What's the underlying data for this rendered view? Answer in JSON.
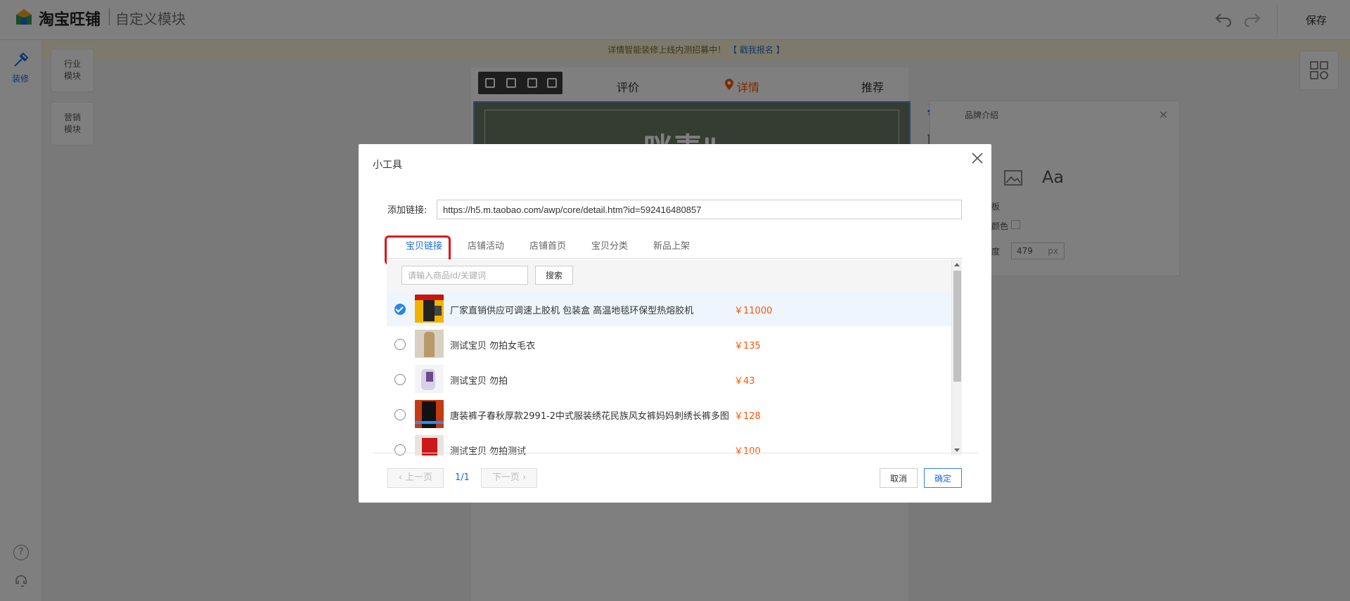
{
  "app": {
    "brand": "淘宝旺铺",
    "subtitle": "自定义模块",
    "save_label": "保存"
  },
  "notice": {
    "text": "详情智能装修上线内测招募中！",
    "link": "【 戳我报名 】"
  },
  "left_rail": {
    "decorate_label": "装修",
    "help_glyph": "?"
  },
  "modules": [
    {
      "line1": "行业",
      "line2": "模块"
    },
    {
      "line1": "营销",
      "line2": "模块"
    }
  ],
  "canvas": {
    "nav": [
      "评价",
      "详情",
      "推荐"
    ],
    "banner_text": "咪麦\""
  },
  "props": {
    "title": "品牌介绍",
    "aa": "Aa",
    "row1": "板",
    "row2": "颜色",
    "row3": "度",
    "width_value": "479",
    "width_unit": "px"
  },
  "dialog": {
    "title": "小工具",
    "link_label": "添加链接:",
    "link_value": "https://h5.m.taobao.com/awp/core/detail.htm?id=592416480857",
    "tabs": [
      "宝贝链接",
      "店铺活动",
      "店铺首页",
      "宝贝分类",
      "新品上架"
    ],
    "active_tab": "宝贝链接",
    "search_placeholder": "请输入商品id/关键词",
    "search_button": "搜索",
    "items": [
      {
        "name": "厂家直销供应可调速上胶机 包装盒 高温地毯环保型热熔胶机",
        "price": "￥11000",
        "selected": true
      },
      {
        "name": "测试宝贝 勿拍女毛衣",
        "price": "￥135",
        "selected": false
      },
      {
        "name": "测试宝贝 勿拍",
        "price": "￥43",
        "selected": false
      },
      {
        "name": "唐装裤子春秋厚款2991-2中式服装绣花民族风女裤妈妈刺绣长裤多图",
        "price": "￥128",
        "selected": false
      },
      {
        "name": "测试宝贝 勿拍测试",
        "price": "￥100",
        "selected": false
      }
    ],
    "pager": {
      "prev": "上一页",
      "next": "下一页",
      "page": "1/1"
    },
    "cancel": "取消",
    "ok": "确定"
  },
  "colors": {
    "accent": "#1a6dd6",
    "price": "#ff5500",
    "highlight": "#e0161b",
    "checked": "#2d86e3"
  }
}
